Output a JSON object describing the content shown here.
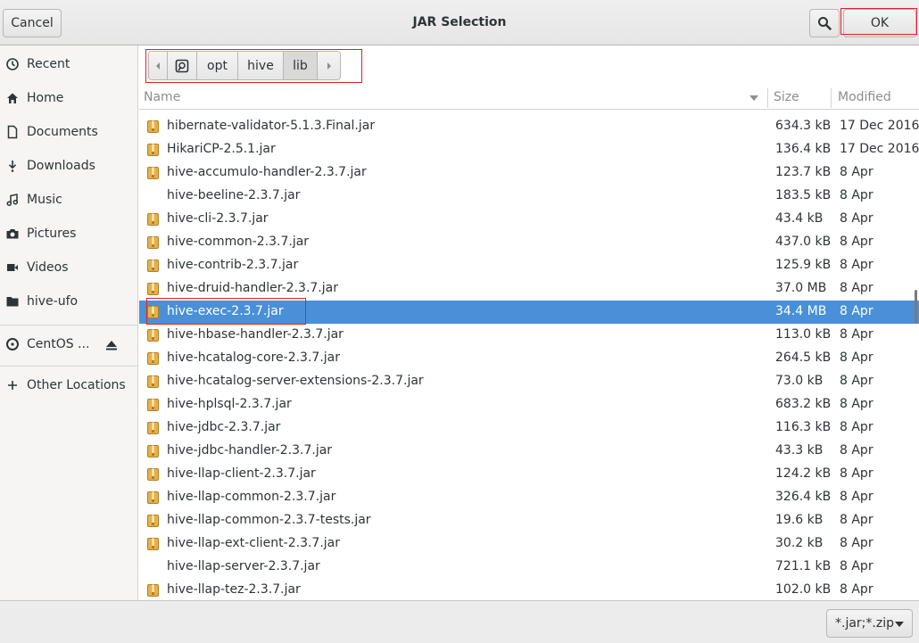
{
  "window": {
    "title": "JAR Selection"
  },
  "header": {
    "cancel_label": "Cancel",
    "ok_label": "OK"
  },
  "sidebar": {
    "items": [
      {
        "label": "Recent",
        "icon": "clock-icon"
      },
      {
        "label": "Home",
        "icon": "home-icon"
      },
      {
        "label": "Documents",
        "icon": "document-icon"
      },
      {
        "label": "Downloads",
        "icon": "download-icon"
      },
      {
        "label": "Music",
        "icon": "music-icon"
      },
      {
        "label": "Pictures",
        "icon": "camera-icon"
      },
      {
        "label": "Videos",
        "icon": "video-icon"
      },
      {
        "label": "hive-ufo",
        "icon": "folder-icon"
      },
      {
        "label": "CentOS ...",
        "icon": "disc-icon"
      },
      {
        "label": "Other Locations",
        "icon": "plus-icon"
      }
    ]
  },
  "pathbar": {
    "segments": [
      "opt",
      "hive",
      "lib"
    ],
    "active": "lib"
  },
  "columns": {
    "name": "Name",
    "size": "Size",
    "modified": "Modified"
  },
  "files": [
    {
      "name": "hibernate-validator-5.1.3.Final.jar",
      "size": "634.3 kB",
      "modified": "17 Dec 2016",
      "icon": true
    },
    {
      "name": "HikariCP-2.5.1.jar",
      "size": "136.4 kB",
      "modified": "17 Dec 2016",
      "icon": true
    },
    {
      "name": "hive-accumulo-handler-2.3.7.jar",
      "size": "123.7 kB",
      "modified": "8 Apr",
      "icon": true
    },
    {
      "name": "hive-beeline-2.3.7.jar",
      "size": "183.5 kB",
      "modified": "8 Apr",
      "icon": false
    },
    {
      "name": "hive-cli-2.3.7.jar",
      "size": "43.4 kB",
      "modified": "8 Apr",
      "icon": true
    },
    {
      "name": "hive-common-2.3.7.jar",
      "size": "437.0 kB",
      "modified": "8 Apr",
      "icon": true
    },
    {
      "name": "hive-contrib-2.3.7.jar",
      "size": "125.9 kB",
      "modified": "8 Apr",
      "icon": true
    },
    {
      "name": "hive-druid-handler-2.3.7.jar",
      "size": "37.0 MB",
      "modified": "8 Apr",
      "icon": true
    },
    {
      "name": "hive-exec-2.3.7.jar",
      "size": "34.4 MB",
      "modified": "8 Apr",
      "icon": true,
      "selected": true
    },
    {
      "name": "hive-hbase-handler-2.3.7.jar",
      "size": "113.0 kB",
      "modified": "8 Apr",
      "icon": true
    },
    {
      "name": "hive-hcatalog-core-2.3.7.jar",
      "size": "264.5 kB",
      "modified": "8 Apr",
      "icon": true
    },
    {
      "name": "hive-hcatalog-server-extensions-2.3.7.jar",
      "size": "73.0 kB",
      "modified": "8 Apr",
      "icon": true
    },
    {
      "name": "hive-hplsql-2.3.7.jar",
      "size": "683.2 kB",
      "modified": "8 Apr",
      "icon": true
    },
    {
      "name": "hive-jdbc-2.3.7.jar",
      "size": "116.3 kB",
      "modified": "8 Apr",
      "icon": true
    },
    {
      "name": "hive-jdbc-handler-2.3.7.jar",
      "size": "43.3 kB",
      "modified": "8 Apr",
      "icon": true
    },
    {
      "name": "hive-llap-client-2.3.7.jar",
      "size": "124.2 kB",
      "modified": "8 Apr",
      "icon": true
    },
    {
      "name": "hive-llap-common-2.3.7.jar",
      "size": "326.4 kB",
      "modified": "8 Apr",
      "icon": true
    },
    {
      "name": "hive-llap-common-2.3.7-tests.jar",
      "size": "19.6 kB",
      "modified": "8 Apr",
      "icon": true
    },
    {
      "name": "hive-llap-ext-client-2.3.7.jar",
      "size": "30.2 kB",
      "modified": "8 Apr",
      "icon": true
    },
    {
      "name": "hive-llap-server-2.3.7.jar",
      "size": "721.1 kB",
      "modified": "8 Apr",
      "icon": false
    },
    {
      "name": "hive-llap-tez-2.3.7.jar",
      "size": "102.0 kB",
      "modified": "8 Apr",
      "icon": true
    }
  ],
  "footer": {
    "filter_label": "*.jar;*.zip"
  },
  "colors": {
    "selection": "#4a90d9",
    "annotation": "#e0202a",
    "archive_icon": "#e8b04a"
  }
}
